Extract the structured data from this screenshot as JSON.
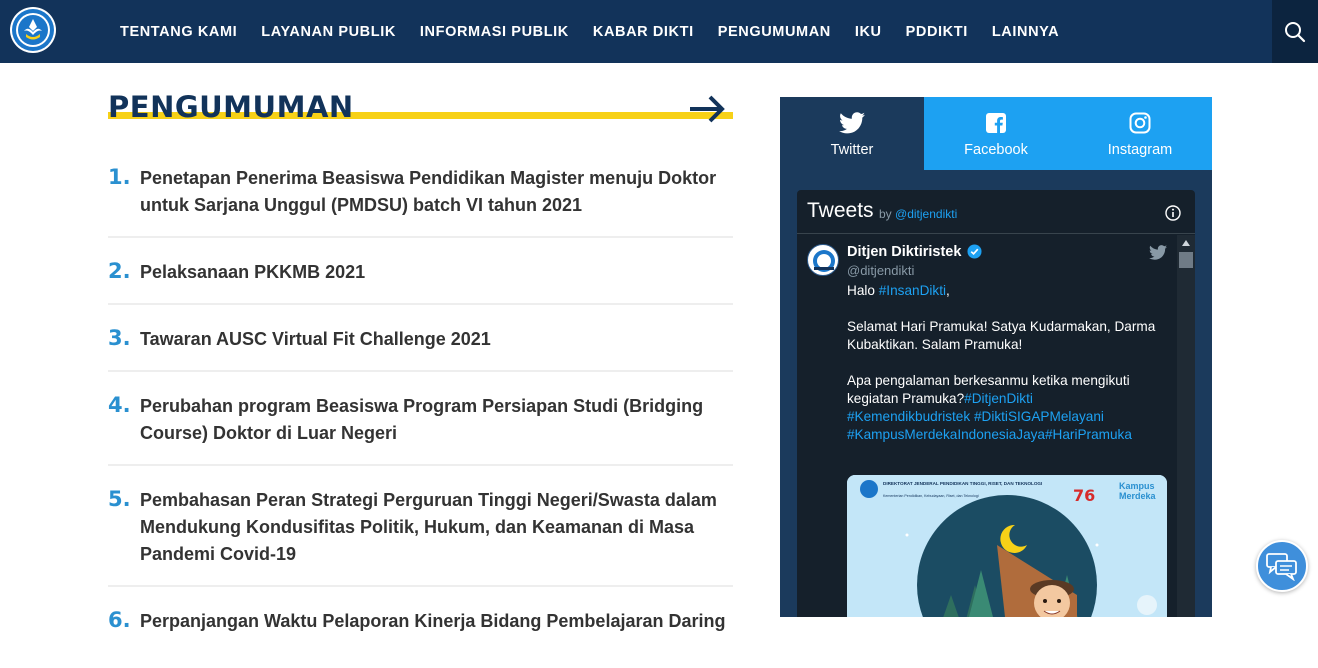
{
  "nav": {
    "items": [
      "TENTANG KAMI",
      "LAYANAN PUBLIK",
      "INFORMASI PUBLIK",
      "KABAR DIKTI",
      "PENGUMUMAN",
      "IKU",
      "PDDIKTI",
      "LAINNYA"
    ]
  },
  "section": {
    "title": "PENGUMUMAN"
  },
  "announcements": [
    {
      "num": "1.",
      "text": "Penetapan Penerima Beasiswa Pendidikan Magister menuju Doktor untuk Sarjana Unggul (PMDSU) batch VI tahun 2021"
    },
    {
      "num": "2.",
      "text": "Pelaksanaan PKKMB 2021"
    },
    {
      "num": "3.",
      "text": "Tawaran AUSC Virtual Fit Challenge 2021"
    },
    {
      "num": "4.",
      "text": "Perubahan program Beasiswa Program Persiapan Studi (Bridging Course) Doktor di Luar Negeri"
    },
    {
      "num": "5.",
      "text": "Pembahasan Peran Strategi Perguruan Tinggi Negeri/Swasta dalam Mendukung Kondusifitas Politik, Hukum, dan Keamanan di Masa Pandemi Covid-19"
    },
    {
      "num": "6.",
      "text": "Perpanjangan Waktu Pelaporan Kinerja Bidang Pembelajaran Daring"
    }
  ],
  "social": {
    "tabs": [
      "Twitter",
      "Facebook",
      "Instagram"
    ],
    "active_tab": "Twitter"
  },
  "twitter": {
    "header_title": "Tweets",
    "header_by": "by",
    "header_handle": "@ditjendikti",
    "author_name": "Ditjen Diktiristek",
    "author_handle": "@ditjendikti",
    "greeting": "Halo",
    "greeting_tag": "#InsanDikti",
    "greeting_end": ",",
    "para2": "Selamat Hari Pramuka! Satya Kudarmakan, Darma Kubaktikan. Salam Pramuka!",
    "para3": "Apa pengalaman berkesanmu ketika mengikuti kegiatan Pramuka?",
    "tag1": "#DitjenDikti",
    "tag2": "#Kemendikbudristek",
    "tag3": "#DiktiSIGAPMelayani",
    "tag4": "#KampusMerdekaIndonesiaJaya",
    "tag5": "#HariPramuka",
    "media_org": "DIREKTORAT JENDERAL PENDIDIKAN TINGGI, RISET, DAN TEKNOLOGI",
    "media_sub": "Kementerian Pendidikan, Kebudayaan, Riset, dan Teknologi",
    "media_76": "76",
    "media_kampus": "Kampus",
    "media_merdeka": "Merdeka"
  },
  "colors": {
    "navbar": "#12335a",
    "accent_yellow": "#f7d117",
    "number_blue": "#2a90d0",
    "twitter_blue": "#1da1f2"
  }
}
